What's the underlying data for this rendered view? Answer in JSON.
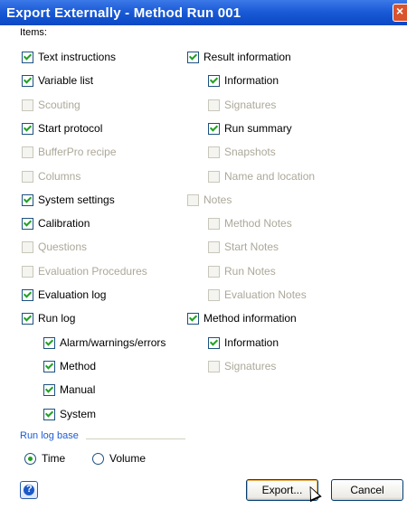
{
  "window": {
    "title": "Export Externally - Method Run  001",
    "close_label": "×"
  },
  "items_label": "Items:",
  "left_column": [
    {
      "label": "Text instructions",
      "checked": true,
      "enabled": true,
      "indent": 0
    },
    {
      "label": "Variable list",
      "checked": true,
      "enabled": true,
      "indent": 0
    },
    {
      "label": "Scouting",
      "checked": false,
      "enabled": false,
      "indent": 0
    },
    {
      "label": "Start protocol",
      "checked": true,
      "enabled": true,
      "indent": 0
    },
    {
      "label": "BufferPro recipe",
      "checked": false,
      "enabled": false,
      "indent": 0
    },
    {
      "label": "Columns",
      "checked": false,
      "enabled": false,
      "indent": 0
    },
    {
      "label": "System settings",
      "checked": true,
      "enabled": true,
      "indent": 0
    },
    {
      "label": "Calibration",
      "checked": true,
      "enabled": true,
      "indent": 0
    },
    {
      "label": "Questions",
      "checked": false,
      "enabled": false,
      "indent": 0
    },
    {
      "label": "Evaluation Procedures",
      "checked": false,
      "enabled": false,
      "indent": 0
    },
    {
      "label": "Evaluation log",
      "checked": true,
      "enabled": true,
      "indent": 0
    },
    {
      "label": "Run log",
      "checked": true,
      "enabled": true,
      "indent": 0
    },
    {
      "label": "Alarm/warnings/errors",
      "checked": true,
      "enabled": true,
      "indent": 1
    },
    {
      "label": "Method",
      "checked": true,
      "enabled": true,
      "indent": 1
    },
    {
      "label": "Manual",
      "checked": true,
      "enabled": true,
      "indent": 1
    },
    {
      "label": "System",
      "checked": true,
      "enabled": true,
      "indent": 1
    }
  ],
  "right_column": [
    {
      "label": "Result information",
      "checked": true,
      "enabled": true,
      "indent": 0
    },
    {
      "label": "Information",
      "checked": true,
      "enabled": true,
      "indent": 1
    },
    {
      "label": "Signatures",
      "checked": false,
      "enabled": false,
      "indent": 1
    },
    {
      "label": "Run summary",
      "checked": true,
      "enabled": true,
      "indent": 1
    },
    {
      "label": "Snapshots",
      "checked": false,
      "enabled": false,
      "indent": 1
    },
    {
      "label": "Name and location",
      "checked": false,
      "enabled": false,
      "indent": 1
    },
    {
      "label": "Notes",
      "checked": false,
      "enabled": false,
      "indent": 0
    },
    {
      "label": "Method Notes",
      "checked": false,
      "enabled": false,
      "indent": 1
    },
    {
      "label": "Start Notes",
      "checked": false,
      "enabled": false,
      "indent": 1
    },
    {
      "label": "Run Notes",
      "checked": false,
      "enabled": false,
      "indent": 1
    },
    {
      "label": "Evaluation Notes",
      "checked": false,
      "enabled": false,
      "indent": 1
    },
    {
      "label": "Method information",
      "checked": true,
      "enabled": true,
      "indent": 0
    },
    {
      "label": "Information",
      "checked": true,
      "enabled": true,
      "indent": 1
    },
    {
      "label": "Signatures",
      "checked": false,
      "enabled": false,
      "indent": 1
    }
  ],
  "run_log_base": {
    "label": "Run log base",
    "options": [
      {
        "label": "Time",
        "selected": true
      },
      {
        "label": "Volume",
        "selected": false
      }
    ]
  },
  "buttons": {
    "help_label": "?",
    "export_label": "Export...",
    "cancel_label": "Cancel"
  },
  "colors": {
    "titlebar": "#0a48c5",
    "check": "#21a121",
    "disabled_text": "#aca899",
    "section_label": "#1c5ed6"
  }
}
